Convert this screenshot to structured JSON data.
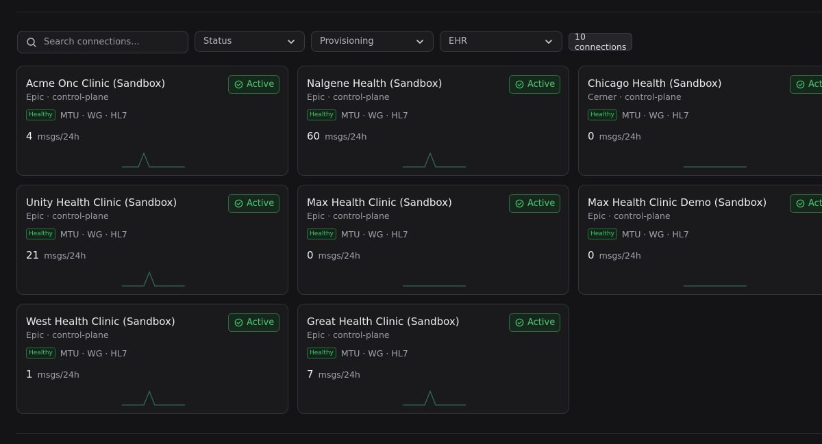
{
  "toolbar": {
    "search_placeholder": "Search connections...",
    "filters": [
      {
        "label": "Status"
      },
      {
        "label": "Provisioning"
      },
      {
        "label": "EHR"
      }
    ],
    "count_label": "10 connections"
  },
  "colors": {
    "accent_green": "#48c970",
    "sparkline": "#2f6b52",
    "background": "#141416",
    "card": "#1a1a1c"
  },
  "cards": [
    {
      "title": "Acme Onc Clinic (Sandbox)",
      "subtitle": "Epic · control-plane",
      "health": "Healthy",
      "tags": "MTU · WG · HL7",
      "msgs": "4",
      "unit": "msgs/24h",
      "status": "Active",
      "spike": true
    },
    {
      "title": "Nalgene Health (Sandbox)",
      "subtitle": "Epic · control-plane",
      "health": "Healthy",
      "tags": "MTU · WG · HL7",
      "msgs": "60",
      "unit": "msgs/24h",
      "status": "Active",
      "spike": true
    },
    {
      "title": "Chicago Health (Sandbox)",
      "subtitle": "Cerner · control-plane",
      "health": "Healthy",
      "tags": "MTU · WG · HL7",
      "msgs": "0",
      "unit": "msgs/24h",
      "status": "Active",
      "spike": false
    },
    {
      "title": "Unity Health Clinic (Sandbox)",
      "subtitle": "Epic · control-plane",
      "health": "Healthy",
      "tags": "MTU · WG · HL7",
      "msgs": "21",
      "unit": "msgs/24h",
      "status": "Active",
      "spike": true
    },
    {
      "title": "Max Health Clinic (Sandbox)",
      "subtitle": "Epic · control-plane",
      "health": "Healthy",
      "tags": "MTU · WG · HL7",
      "msgs": "0",
      "unit": "msgs/24h",
      "status": "Active",
      "spike": false
    },
    {
      "title": "Max Health Clinic Demo (Sandbox)",
      "subtitle": "Epic · control-plane",
      "health": "Healthy",
      "tags": "MTU · WG · HL7",
      "msgs": "0",
      "unit": "msgs/24h",
      "status": "Active",
      "spike": false
    },
    {
      "title": "West Health Clinic (Sandbox)",
      "subtitle": "Epic · control-plane",
      "health": "Healthy",
      "tags": "MTU · WG · HL7",
      "msgs": "1",
      "unit": "msgs/24h",
      "status": "Active",
      "spike": true
    },
    {
      "title": "Great Health Clinic (Sandbox)",
      "subtitle": "Epic · control-plane",
      "health": "Healthy",
      "tags": "MTU · WG · HL7",
      "msgs": "7",
      "unit": "msgs/24h",
      "status": "Active",
      "spike": true
    }
  ]
}
